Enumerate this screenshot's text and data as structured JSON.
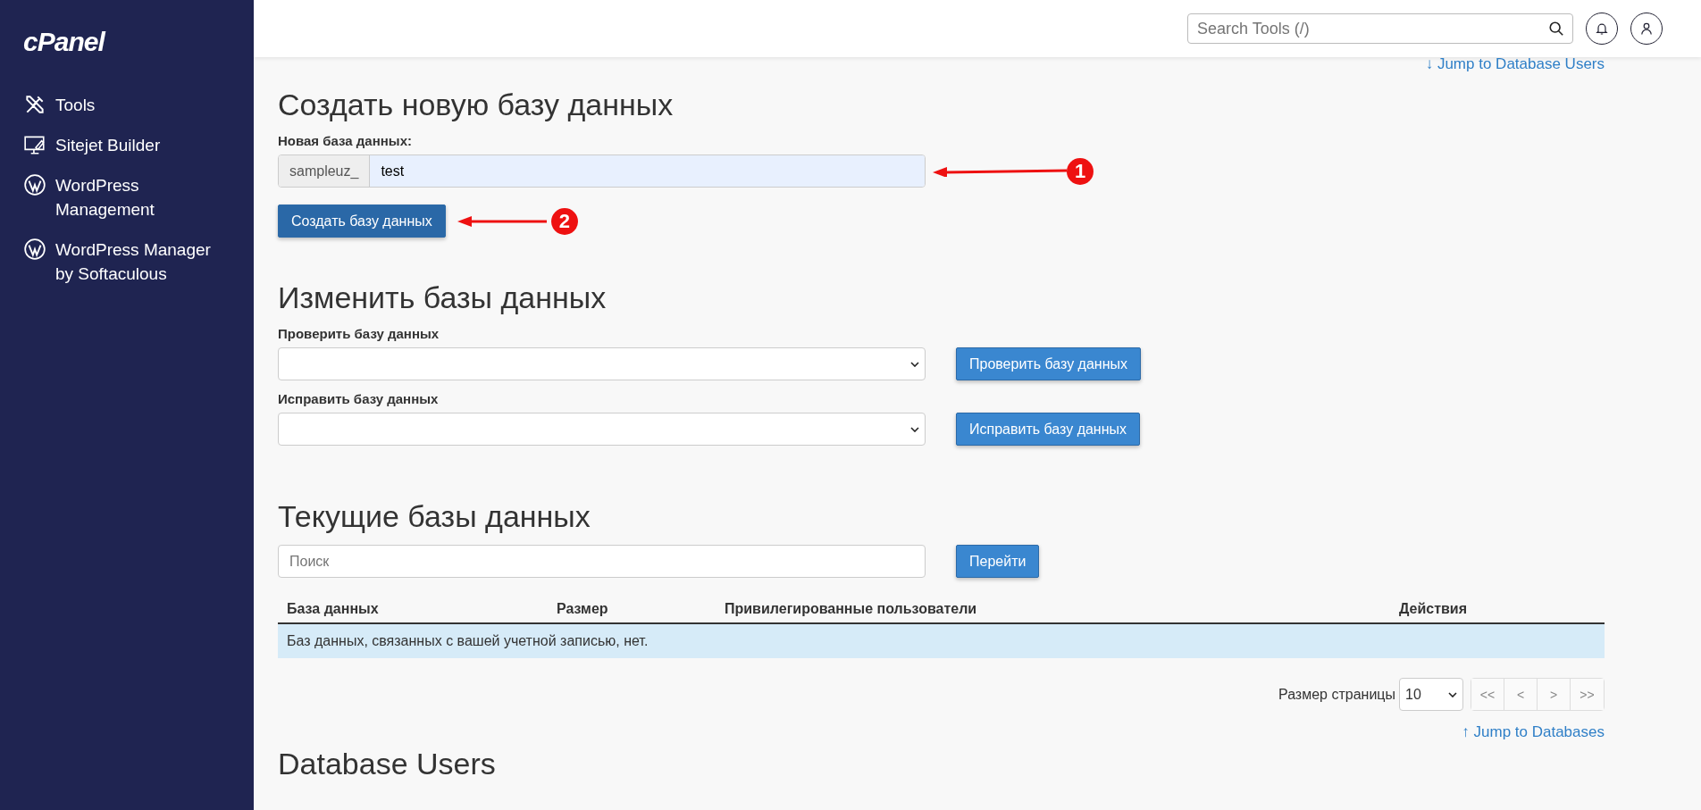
{
  "sidebar": {
    "logo": "cPanel",
    "items": [
      {
        "label": "Tools",
        "kind": "tools"
      },
      {
        "label": "Sitejet Builder",
        "kind": "monitor"
      },
      {
        "label": "WordPress Management",
        "kind": "wordpress"
      },
      {
        "label": "WordPress Manager by Softaculous",
        "kind": "wordpress"
      }
    ]
  },
  "header": {
    "search": {
      "placeholder": "Search Tools (/)"
    }
  },
  "jump_top": {
    "arrow": "↓",
    "label": "Jump to Database Users"
  },
  "create": {
    "title": "Создать новую базу данных",
    "label": "Новая база данных:",
    "prefix": "sampleuz_",
    "value": "test",
    "button": "Создать базу данных"
  },
  "modify": {
    "title": "Изменить базы данных",
    "rows": [
      {
        "label": "Проверить базу данных",
        "button": "Проверить базу данных"
      },
      {
        "label": "Исправить базу данных",
        "button": "Исправить базу данных"
      }
    ]
  },
  "current": {
    "title": "Текущие базы данных",
    "search": {
      "placeholder": "Поиск"
    },
    "go_button": "Перейти",
    "table": {
      "columns": [
        "База данных",
        "Размер",
        "Привилегированные пользователи",
        "Действия"
      ],
      "empty_message": "Баз данных, связанных с вашей учетной записью, нет."
    },
    "pagination": {
      "label": "Размер страницы",
      "page_size": "10",
      "buttons": [
        "<<",
        "<",
        ">",
        ">>"
      ]
    }
  },
  "jump_bottom": {
    "arrow": "↑",
    "label": "Jump to Databases"
  },
  "users": {
    "title": "Database Users"
  },
  "annotations": [
    {
      "number": "1"
    },
    {
      "number": "2"
    }
  ]
}
